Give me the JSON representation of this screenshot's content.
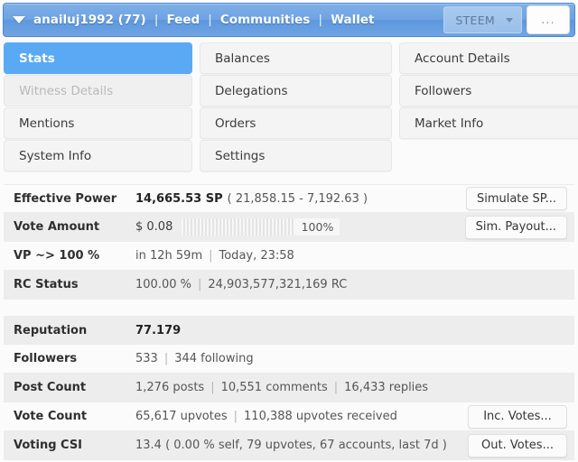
{
  "navbar": {
    "caret_icon": "caret-down-icon",
    "account": "anailuj1992 (77)",
    "links": [
      "Feed",
      "Communities",
      "Wallet"
    ],
    "separator": "|",
    "currency_select": {
      "value": "STEEM",
      "chevron_icon": "chevron-down-icon"
    },
    "more_button": "...",
    "accent_color": "#6ea3e2"
  },
  "tabs": [
    {
      "label": "Stats",
      "state": "active"
    },
    {
      "label": "Balances",
      "state": "normal"
    },
    {
      "label": "Account Details",
      "state": "normal"
    },
    {
      "label": "Witness Details",
      "state": "disabled"
    },
    {
      "label": "Delegations",
      "state": "normal"
    },
    {
      "label": "Followers",
      "state": "normal"
    },
    {
      "label": "Mentions",
      "state": "normal"
    },
    {
      "label": "Orders",
      "state": "normal"
    },
    {
      "label": "Market Info",
      "state": "normal"
    },
    {
      "label": "System Info",
      "state": "normal"
    },
    {
      "label": "Settings",
      "state": "normal"
    },
    {
      "label": "",
      "state": "empty"
    }
  ],
  "active_tab_color": "#5aa9f5",
  "stats_primary": {
    "effective_power": {
      "label": "Effective Power",
      "value_main": "14,665.53 SP",
      "value_detail": "( 21,858.15 - 7,192.63 )",
      "button": "Simulate SP..."
    },
    "vote_amount": {
      "label": "Vote Amount",
      "amount": "$ 0.08",
      "percent_label": "100%",
      "percent_value": 100,
      "button": "Sim. Payout..."
    },
    "vp_to_100": {
      "label": "VP ~> 100 %",
      "time_remaining": "in 12h 59m",
      "eta": "Today, 23:58"
    },
    "rc_status": {
      "label": "RC Status",
      "percent": "100.00 %",
      "rc": "24,903,577,321,169 RC"
    }
  },
  "stats_secondary": {
    "reputation": {
      "label": "Reputation",
      "value": "77.179"
    },
    "followers": {
      "label": "Followers",
      "count": "533",
      "following": "344 following"
    },
    "post_count": {
      "label": "Post Count",
      "posts": "1,276 posts",
      "comments": "10,551 comments",
      "replies": "16,433 replies"
    },
    "vote_count": {
      "label": "Vote Count",
      "given": "65,617 upvotes",
      "received": "110,388 upvotes received",
      "button": "Inc. Votes..."
    },
    "voting_csi": {
      "label": "Voting CSI",
      "value": "13.4 ( 0.00 % self, 79 upvotes, 67 accounts, last 7d )",
      "button": "Out. Votes..."
    }
  },
  "separators": {
    "pipe": "|"
  }
}
